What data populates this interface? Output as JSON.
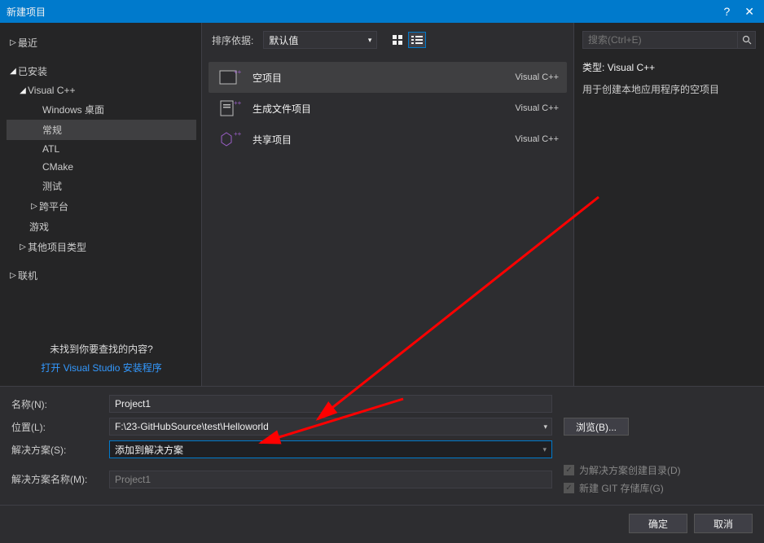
{
  "window": {
    "title": "新建项目",
    "help": "?",
    "close": "✕"
  },
  "tree": {
    "recent": "最近",
    "installed": "已安装",
    "vcpp": "Visual C++",
    "vcpp_children": [
      "Windows 桌面",
      "常规",
      "ATL",
      "CMake",
      "测试",
      "跨平台"
    ],
    "games": "游戏",
    "other_types": "其他项目类型",
    "online": "联机"
  },
  "sidebar_footer": {
    "hint": "未找到你要查找的内容?",
    "link": "打开 Visual Studio 安装程序"
  },
  "toolbar": {
    "sort_label": "排序依据:",
    "sort_value": "默认值"
  },
  "templates": [
    {
      "name": "空项目",
      "lang": "Visual C++"
    },
    {
      "name": "生成文件项目",
      "lang": "Visual C++"
    },
    {
      "name": "共享项目",
      "lang": "Visual C++"
    }
  ],
  "search": {
    "placeholder": "搜索(Ctrl+E)"
  },
  "details": {
    "type_label": "类型:",
    "type_value": "Visual C++",
    "description": "用于创建本地应用程序的空项目"
  },
  "form": {
    "name_label": "名称(N):",
    "name_value": "Project1",
    "location_label": "位置(L):",
    "location_value": "F:\\23-GitHubSource\\test\\Helloworld",
    "solution_label": "解决方案(S):",
    "solution_value": "添加到解决方案",
    "solution_name_label": "解决方案名称(M):",
    "solution_name_value": "Project1",
    "browse": "浏览(B)...",
    "checkbox1": "为解决方案创建目录(D)",
    "checkbox2": "新建 GIT 存储库(G)"
  },
  "buttons": {
    "ok": "确定",
    "cancel": "取消"
  }
}
